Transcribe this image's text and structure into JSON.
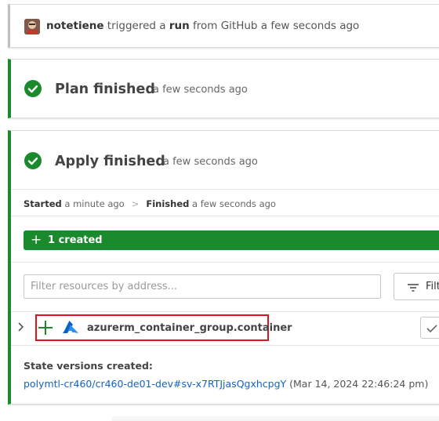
{
  "trigger": {
    "user": "notetiene",
    "text_1": " triggered a ",
    "run": "run",
    "text_2": " from GitHub a few seconds ago"
  },
  "plan": {
    "title": "Plan finished",
    "time": "a few seconds ago"
  },
  "apply": {
    "title": "Apply finished",
    "time": "a few seconds ago",
    "started_label": "Started",
    "started_time": " a minute ago",
    "separator": ">",
    "finished_label": "Finished",
    "finished_time": " a few seconds ago"
  },
  "summary": {
    "created_icon": "+",
    "created_label": "1 created"
  },
  "filter": {
    "placeholder": "Filter resources by address...",
    "button_label": "Filt"
  },
  "resource": {
    "action_icon": "plus-icon",
    "provider_icon": "azure-icon",
    "name": "azurerm_container_group.container"
  },
  "state": {
    "label": "State versions created:",
    "link": "polymtl-cr460/cr460-de01-dev#sv-x7RTJjasQgxhcpgY",
    "timestamp": " (Mar 14, 2024 22:46:24 pm)"
  },
  "colors": {
    "success": "#1a8a2c",
    "link": "#1463c2",
    "highlight": "#e0121f"
  }
}
